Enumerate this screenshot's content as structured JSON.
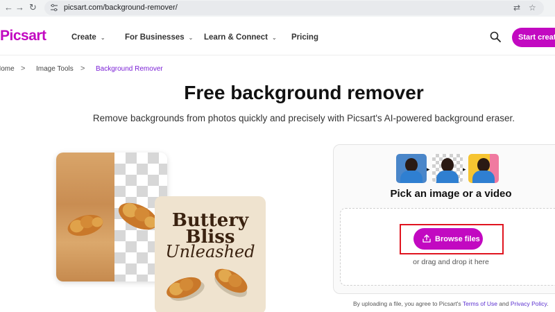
{
  "browser": {
    "back_icon": "arrow-left",
    "forward_icon": "arrow-right",
    "reload_icon": "reload",
    "url": "picsart.com/background-remover/",
    "translate_icon": "translate",
    "star_icon": "star"
  },
  "header": {
    "logo": "Picsart",
    "nav": [
      {
        "label": "Create"
      },
      {
        "label": "For Businesses"
      },
      {
        "label": "Learn & Connect"
      },
      {
        "label": "Pricing"
      }
    ],
    "start_button": "Start creating"
  },
  "breadcrumb": {
    "items": [
      "Home",
      "Image Tools",
      "Background Remover"
    ],
    "separator": ">"
  },
  "hero": {
    "title": "Free background remover",
    "subtitle": "Remove backgrounds from photos quickly and precisely with Picsart's AI-powered background eraser."
  },
  "poster": {
    "line1": "Buttery",
    "line2": "Bliss",
    "line3": "Unleashed"
  },
  "upload": {
    "title": "Pick an image or a video",
    "browse_label": "Browse files",
    "drag_text": "or drag and drop it here",
    "terms_prefix": "By uploading a file, you agree to Picsart's ",
    "terms_link": "Terms of Use",
    "terms_and": " and ",
    "privacy_link": "Privacy Policy",
    "terms_suffix": "."
  },
  "colors": {
    "brand": "#c209c1",
    "breadcrumb_active": "#7a1fd6",
    "highlight": "#e0141f"
  }
}
